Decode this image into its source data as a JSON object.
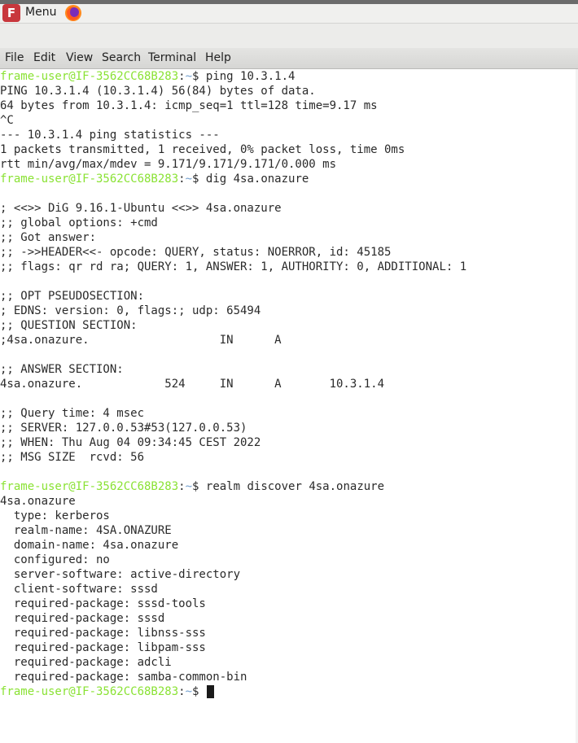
{
  "panel": {
    "menu_label": "Menu",
    "app_icon_letter": "F"
  },
  "menubar": {
    "items": [
      "File",
      "Edit",
      "View",
      "Search",
      "Terminal",
      "Help"
    ]
  },
  "terminal": {
    "prompt": {
      "userhost": "frame-user@IF-3562CC68B283",
      "sep": ":",
      "dir": "~",
      "symbol": "$ "
    },
    "lines": [
      {
        "prompt": true,
        "text": "ping 10.3.1.4"
      },
      {
        "text": "PING 10.3.1.4 (10.3.1.4) 56(84) bytes of data."
      },
      {
        "text": "64 bytes from 10.3.1.4: icmp_seq=1 ttl=128 time=9.17 ms"
      },
      {
        "text": "^C"
      },
      {
        "text": "--- 10.3.1.4 ping statistics ---"
      },
      {
        "text": "1 packets transmitted, 1 received, 0% packet loss, time 0ms"
      },
      {
        "text": "rtt min/avg/max/mdev = 9.171/9.171/9.171/0.000 ms"
      },
      {
        "prompt": true,
        "text": "dig 4sa.onazure"
      },
      {
        "text": ""
      },
      {
        "text": "; <<>> DiG 9.16.1-Ubuntu <<>> 4sa.onazure"
      },
      {
        "text": ";; global options: +cmd"
      },
      {
        "text": ";; Got answer:"
      },
      {
        "text": ";; ->>HEADER<<- opcode: QUERY, status: NOERROR, id: 45185"
      },
      {
        "text": ";; flags: qr rd ra; QUERY: 1, ANSWER: 1, AUTHORITY: 0, ADDITIONAL: 1"
      },
      {
        "text": ""
      },
      {
        "text": ";; OPT PSEUDOSECTION:"
      },
      {
        "text": "; EDNS: version: 0, flags:; udp: 65494"
      },
      {
        "text": ";; QUESTION SECTION:"
      },
      {
        "text": ";4sa.onazure.                   IN      A"
      },
      {
        "text": ""
      },
      {
        "text": ";; ANSWER SECTION:"
      },
      {
        "text": "4sa.onazure.            524     IN      A       10.3.1.4"
      },
      {
        "text": ""
      },
      {
        "text": ";; Query time: 4 msec"
      },
      {
        "text": ";; SERVER: 127.0.0.53#53(127.0.0.53)"
      },
      {
        "text": ";; WHEN: Thu Aug 04 09:34:45 CEST 2022"
      },
      {
        "text": ";; MSG SIZE  rcvd: 56"
      },
      {
        "text": ""
      },
      {
        "prompt": true,
        "text": "realm discover 4sa.onazure"
      },
      {
        "text": "4sa.onazure"
      },
      {
        "text": "  type: kerberos"
      },
      {
        "text": "  realm-name: 4SA.ONAZURE"
      },
      {
        "text": "  domain-name: 4sa.onazure"
      },
      {
        "text": "  configured: no"
      },
      {
        "text": "  server-software: active-directory"
      },
      {
        "text": "  client-software: sssd"
      },
      {
        "text": "  required-package: sssd-tools"
      },
      {
        "text": "  required-package: sssd"
      },
      {
        "text": "  required-package: libnss-sss"
      },
      {
        "text": "  required-package: libpam-sss"
      },
      {
        "text": "  required-package: adcli"
      },
      {
        "text": "  required-package: samba-common-bin"
      },
      {
        "prompt": true,
        "text": "",
        "cursor": true
      }
    ]
  },
  "colors": {
    "prompt_userhost": "#8ae234",
    "prompt_dir": "#729fcf",
    "terminal_bg": "#ffffff",
    "terminal_fg": "#2a2a2a"
  }
}
